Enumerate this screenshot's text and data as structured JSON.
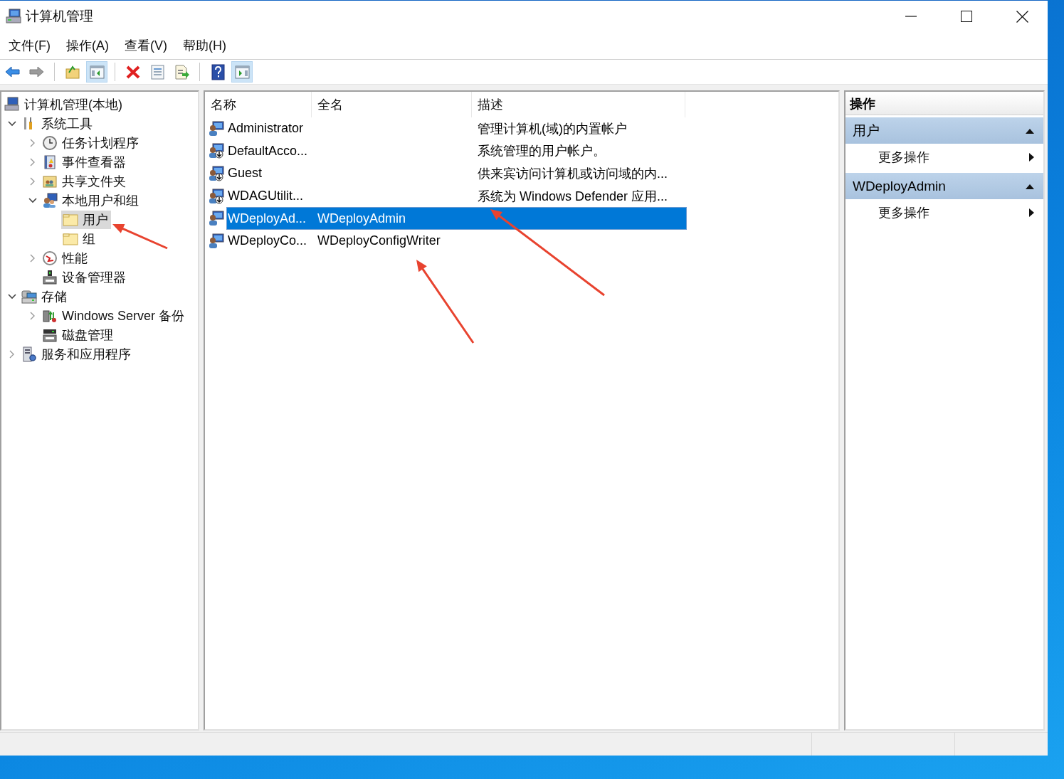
{
  "window": {
    "title": "计算机管理"
  },
  "menu": [
    "文件(F)",
    "操作(A)",
    "查看(V)",
    "帮助(H)"
  ],
  "toolbar": [
    {
      "kind": "button",
      "pressed": false,
      "disabled": false
    },
    {
      "kind": "button",
      "pressed": false,
      "disabled": true
    },
    {
      "kind": "separator"
    },
    {
      "kind": "button",
      "pressed": false,
      "disabled": false
    },
    {
      "kind": "button",
      "pressed": true,
      "disabled": false
    },
    {
      "kind": "separator"
    },
    {
      "kind": "button",
      "pressed": false,
      "disabled": false
    },
    {
      "kind": "button",
      "pressed": false,
      "disabled": false
    },
    {
      "kind": "button",
      "pressed": false,
      "disabled": false
    },
    {
      "kind": "separator"
    },
    {
      "kind": "button",
      "pressed": false,
      "disabled": false
    },
    {
      "kind": "button",
      "pressed": true,
      "disabled": false
    }
  ],
  "tree": [
    {
      "label": "计算机管理(本地)",
      "expandable": false,
      "selected": false,
      "marked": false,
      "children": [
        {
          "label": "系统工具",
          "expandable": true,
          "expanded": true,
          "selected": false,
          "marked": false,
          "children": [
            {
              "label": "任务计划程序",
              "expandable": true,
              "expanded": false,
              "selected": false,
              "marked": false
            },
            {
              "label": "事件查看器",
              "expandable": true,
              "expanded": false,
              "selected": false,
              "marked": false
            },
            {
              "label": "共享文件夹",
              "expandable": true,
              "expanded": false,
              "selected": false,
              "marked": false
            },
            {
              "label": "本地用户和组",
              "expandable": true,
              "expanded": true,
              "selected": false,
              "marked": false,
              "children": [
                {
                  "label": "用户",
                  "expandable": false,
                  "selected": true,
                  "marked": true
                },
                {
                  "label": "组",
                  "expandable": false,
                  "selected": false,
                  "marked": false
                }
              ]
            },
            {
              "label": "性能",
              "expandable": true,
              "expanded": false,
              "selected": false,
              "marked": false
            },
            {
              "label": "设备管理器",
              "expandable": false,
              "selected": false,
              "marked": false
            }
          ]
        },
        {
          "label": "存储",
          "expandable": true,
          "expanded": true,
          "selected": false,
          "marked": false,
          "children": [
            {
              "label": "Windows Server 备份",
              "expandable": true,
              "expanded": false,
              "selected": false,
              "marked": false
            },
            {
              "label": "磁盘管理",
              "expandable": false,
              "selected": false,
              "marked": false
            }
          ]
        },
        {
          "label": "服务和应用程序",
          "expandable": true,
          "expanded": false,
          "selected": false,
          "marked": false
        }
      ]
    }
  ],
  "table": {
    "columns": [
      "名称",
      "全名",
      "描述"
    ],
    "rows": [
      {
        "name": "Administrator",
        "full_name": "",
        "description": "管理计算机(域)的内置帐户",
        "disabled": false,
        "selected": false,
        "marked": false
      },
      {
        "name": "DefaultAcco...",
        "full_name": "",
        "description": "系统管理的用户帐户。",
        "disabled": true,
        "selected": false,
        "marked": false
      },
      {
        "name": "Guest",
        "full_name": "",
        "description": "供来宾访问计算机或访问域的内...",
        "disabled": true,
        "selected": false,
        "marked": false
      },
      {
        "name": "WDAGUtilit...",
        "full_name": "",
        "description": "系统为 Windows Defender 应用...",
        "disabled": true,
        "selected": false,
        "marked": false
      },
      {
        "name": "WDeployAd...",
        "full_name": "WDeployAdmin",
        "description": "",
        "disabled": false,
        "selected": true,
        "marked": true
      },
      {
        "name": "WDeployCo...",
        "full_name": "WDeployConfigWriter",
        "description": "",
        "disabled": false,
        "selected": false,
        "marked": true
      }
    ]
  },
  "actions": {
    "title": "操作",
    "sections": [
      {
        "title": "用户",
        "expanded": true,
        "items": [
          "更多操作"
        ]
      },
      {
        "title": "WDeployAdmin",
        "expanded": true,
        "items": [
          "更多操作"
        ]
      }
    ]
  }
}
